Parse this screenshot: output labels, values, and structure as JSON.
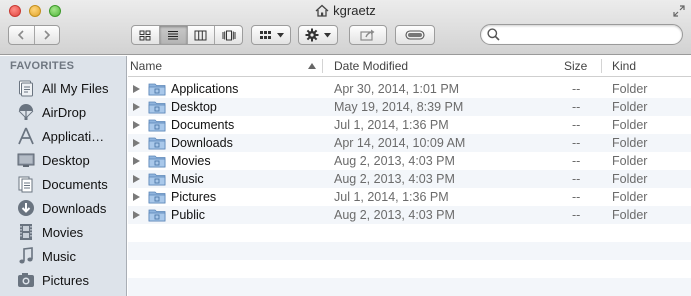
{
  "window": {
    "title": "kgraetz"
  },
  "toolbar": {
    "back_icon": "chevron-left-icon",
    "forward_icon": "chevron-right-icon",
    "views": [
      "icon-view",
      "list-view",
      "column-view",
      "cover-flow-view"
    ],
    "active_view": "list-view",
    "arrange_icon": "arrange-grid-icon",
    "action_icon": "gear-icon",
    "share_icon": "share-icon",
    "tags_icon": "tags-toggle-icon",
    "search": {
      "placeholder": "",
      "value": ""
    }
  },
  "sidebar": {
    "heading": "FAVORITES",
    "items": [
      {
        "label": "All My Files",
        "icon": "all-files-icon"
      },
      {
        "label": "AirDrop",
        "icon": "airdrop-icon"
      },
      {
        "label": "Applicati…",
        "icon": "applications-icon"
      },
      {
        "label": "Desktop",
        "icon": "desktop-icon"
      },
      {
        "label": "Documents",
        "icon": "documents-icon"
      },
      {
        "label": "Downloads",
        "icon": "downloads-icon"
      },
      {
        "label": "Movies",
        "icon": "movies-icon"
      },
      {
        "label": "Music",
        "icon": "music-icon"
      },
      {
        "label": "Pictures",
        "icon": "pictures-icon"
      }
    ]
  },
  "list": {
    "columns": {
      "name": "Name",
      "date": "Date Modified",
      "size": "Size",
      "kind": "Kind"
    },
    "sort_column": "name",
    "sort_direction": "ascending",
    "rows": [
      {
        "name": "Applications",
        "date": "Apr 30, 2014, 1:01 PM",
        "size": "--",
        "kind": "Folder",
        "icon": "applications-folder-icon"
      },
      {
        "name": "Desktop",
        "date": "May 19, 2014, 8:39 PM",
        "size": "--",
        "kind": "Folder",
        "icon": "desktop-folder-icon"
      },
      {
        "name": "Documents",
        "date": "Jul 1, 2014, 1:36 PM",
        "size": "--",
        "kind": "Folder",
        "icon": "documents-folder-icon"
      },
      {
        "name": "Downloads",
        "date": "Apr 14, 2014, 10:09 AM",
        "size": "--",
        "kind": "Folder",
        "icon": "downloads-folder-icon"
      },
      {
        "name": "Movies",
        "date": "Aug 2, 2013, 4:03 PM",
        "size": "--",
        "kind": "Folder",
        "icon": "movies-folder-icon"
      },
      {
        "name": "Music",
        "date": "Aug 2, 2013, 4:03 PM",
        "size": "--",
        "kind": "Folder",
        "icon": "music-folder-icon"
      },
      {
        "name": "Pictures",
        "date": "Jul 1, 2014, 1:36 PM",
        "size": "--",
        "kind": "Folder",
        "icon": "pictures-folder-icon"
      },
      {
        "name": "Public",
        "date": "Aug 2, 2013, 4:03 PM",
        "size": "--",
        "kind": "Folder",
        "icon": "public-folder-icon"
      }
    ]
  },
  "colors": {
    "sidebar_bg": "#dde3ea",
    "row_stripe": "#f3f6fa",
    "folder_blue": "#8fb4dd"
  }
}
